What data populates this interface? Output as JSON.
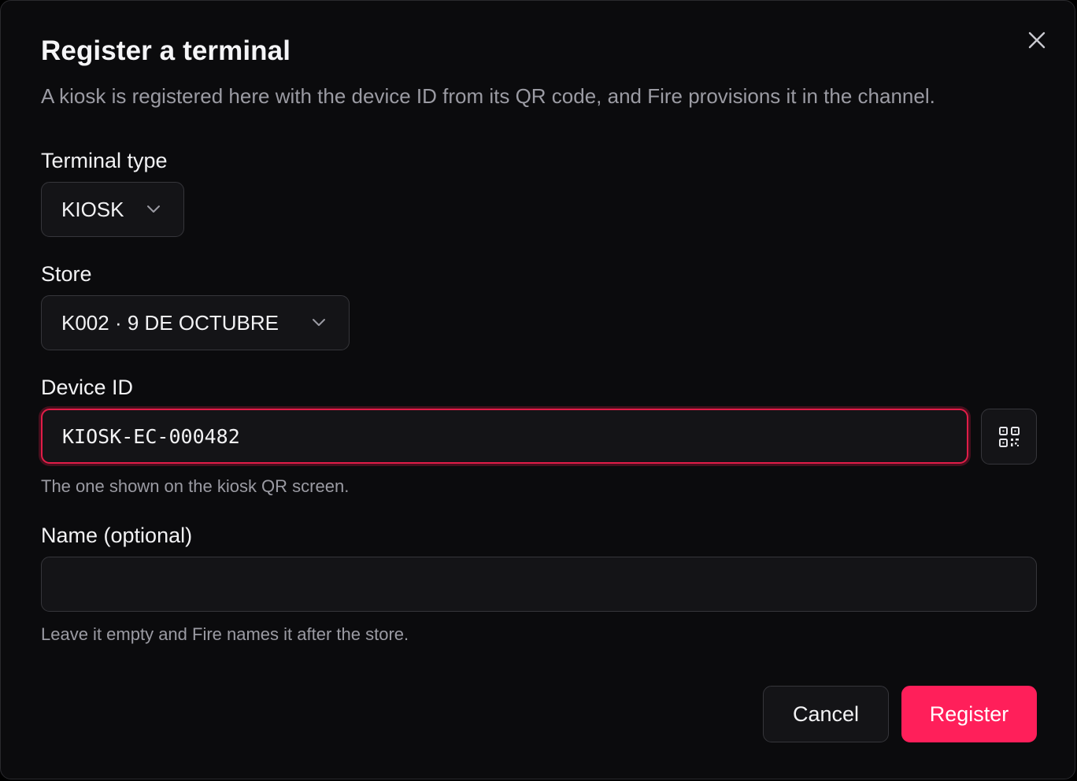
{
  "dialog": {
    "title": "Register a terminal",
    "subtitle": "A kiosk is registered here with the device ID from its QR code, and Fire provisions it in the channel.",
    "close_icon": "close-icon"
  },
  "terminal_type": {
    "label": "Terminal type",
    "value": "KIOSK"
  },
  "store": {
    "label": "Store",
    "value": "K002 · 9 DE OCTUBRE"
  },
  "device_id": {
    "label": "Device ID",
    "value": "KIOSK-EC-000482",
    "hint": "The one shown on the kiosk QR screen.",
    "scan_icon": "qr-code-icon",
    "state": "invalid"
  },
  "name": {
    "label": "Name (optional)",
    "value": "",
    "hint": "Leave it empty and Fire names it after the store."
  },
  "actions": {
    "cancel_label": "Cancel",
    "register_label": "Register"
  },
  "colors": {
    "accent": "#ff1f5a",
    "error_border": "#e11d48",
    "background": "#0b0b0d"
  }
}
